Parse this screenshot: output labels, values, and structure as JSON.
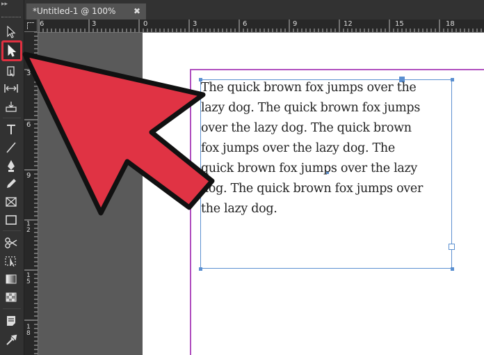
{
  "document": {
    "tab_title": "*Untitled-1 @ 100%",
    "tab_close": "✖"
  },
  "rulers": {
    "horizontal": [
      "6",
      "3",
      "0",
      "3",
      "6",
      "9",
      "12",
      "15",
      "18"
    ],
    "vertical": [
      "3",
      "6",
      "9",
      "1\n2",
      "1\n5",
      "1\n8"
    ]
  },
  "text_frame": {
    "content": "The quick brown fox jumps over the\nlazy dog. The quick brown fox jumps\nover the lazy dog. The quick brown\nfox jumps over the lazy dog. The\nquick brown fox jumps over the lazy\ndog. The quick brown fox jumps over\nthe lazy dog."
  },
  "toolbar": {
    "tools": [
      "selection-tool",
      "direct-selection-tool",
      "page-tool",
      "gap-tool",
      "content-collector-tool",
      "type-tool",
      "line-tool",
      "pen-tool",
      "pencil-tool",
      "rectangle-frame-tool",
      "rectangle-tool",
      "scissors-tool",
      "free-transform-tool",
      "gradient-swatch-tool",
      "gradient-feather-tool",
      "note-tool",
      "eyedropper-tool"
    ],
    "highlighted_tool": "direct-selection-tool"
  },
  "colors": {
    "annotation_arrow": "#e03344",
    "margin_guide": "#b04fbf",
    "frame_edge": "#5a8fd0"
  }
}
